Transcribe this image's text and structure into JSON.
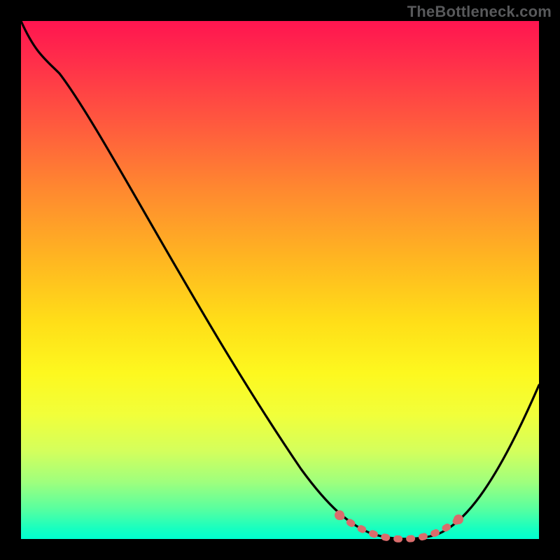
{
  "watermark": "TheBottleneck.com",
  "chart_data": {
    "type": "line",
    "title": "",
    "xlabel": "",
    "ylabel": "",
    "xlim": [
      0,
      100
    ],
    "ylim": [
      0,
      100
    ],
    "grid": false,
    "legend": false,
    "series": [
      {
        "name": "bottleneck-curve",
        "color": "#000000",
        "x": [
          0,
          4,
          10,
          18,
          26,
          34,
          42,
          50,
          56,
          60,
          64,
          68,
          72,
          76,
          80,
          84,
          88,
          92,
          96,
          100
        ],
        "y": [
          100,
          96,
          91,
          82,
          71,
          60,
          48,
          35,
          24,
          16,
          9,
          4,
          1,
          0,
          0,
          1,
          5,
          13,
          25,
          40
        ]
      },
      {
        "name": "optimal-range",
        "color": "#e06666",
        "x": [
          64,
          68,
          72,
          76,
          80,
          84
        ],
        "y": [
          9,
          4,
          1,
          0,
          0,
          1
        ]
      }
    ],
    "markers": [
      {
        "name": "optimal-start",
        "x": 64,
        "y": 9,
        "color": "#e06666"
      },
      {
        "name": "optimal-end",
        "x": 84,
        "y": 1,
        "color": "#e06666"
      }
    ],
    "gradient_description": "vertical red-to-green (high=bad, low=good)"
  }
}
